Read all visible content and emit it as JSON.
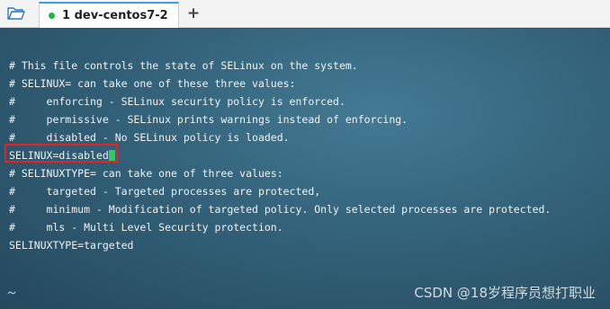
{
  "toolbar": {
    "folder_icon": "folder-open-icon"
  },
  "tab": {
    "label": "1 dev-centos7-2",
    "status_color": "#22b24c",
    "accent": "#3aa0de"
  },
  "add_tab": {
    "label": "+"
  },
  "terminal": {
    "lines": [
      "# This file controls the state of SELinux on the system.",
      "# SELINUX= can take one of these three values:",
      "#     enforcing - SELinux security policy is enforced.",
      "#     permissive - SELinux prints warnings instead of enforcing.",
      "#     disabled - No SELinux policy is loaded.",
      "SELINUX=disabled",
      "# SELINUXTYPE= can take one of three values:",
      "#     targeted - Targeted processes are protected,",
      "#     minimum - Modification of targeted policy. Only selected processes are protected.",
      "#     mls - Multi Level Security protection.",
      "SELINUXTYPE=targeted"
    ],
    "highlight_color": "#e0242a",
    "cursor_color": "#2ecc5a"
  },
  "watermark": "CSDN @18岁程序员想打职业"
}
